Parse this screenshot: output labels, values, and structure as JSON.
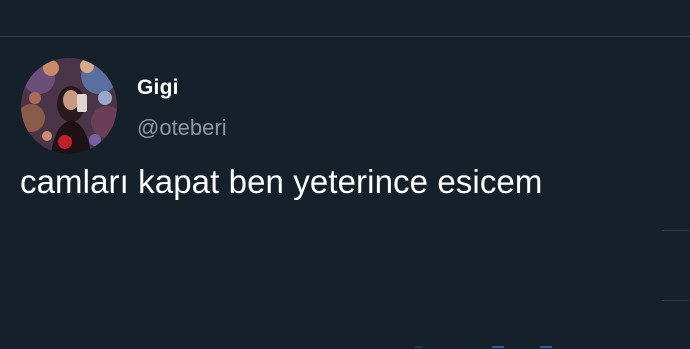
{
  "tweet": {
    "author": {
      "display_name": "Gigi",
      "handle": "@oteberi"
    },
    "text": "camları kapat ben yeterince esicem"
  },
  "colors": {
    "background": "#15202b",
    "divider": "#38444d",
    "text_primary": "#ffffff",
    "text_secondary": "#8b98a5"
  }
}
